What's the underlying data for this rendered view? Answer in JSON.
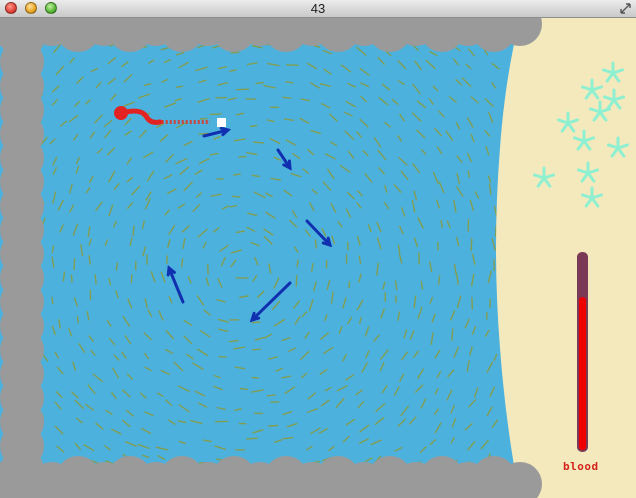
{
  "window": {
    "title": "43",
    "buttons": [
      "close",
      "minimize",
      "zoom"
    ],
    "resize_icon": "resize-diagonal-icon"
  },
  "game": {
    "water_color": "#4db1de",
    "sand_color": "#f4e9bd",
    "rock_color": "#9a9a9a",
    "current_stroke_color": "#8a9a3a",
    "player_color": "#e32222",
    "enemy_color": "#1030b0",
    "plant_color": "#8ef0d0",
    "pickup_color": "#ffffff",
    "plant_icon": "starfish-plant-icon"
  },
  "hud": {
    "blood_label": "blood",
    "blood_level": 0.78,
    "blood_fill_color": "#ee0000",
    "blood_empty_color": "#7a3a55"
  }
}
